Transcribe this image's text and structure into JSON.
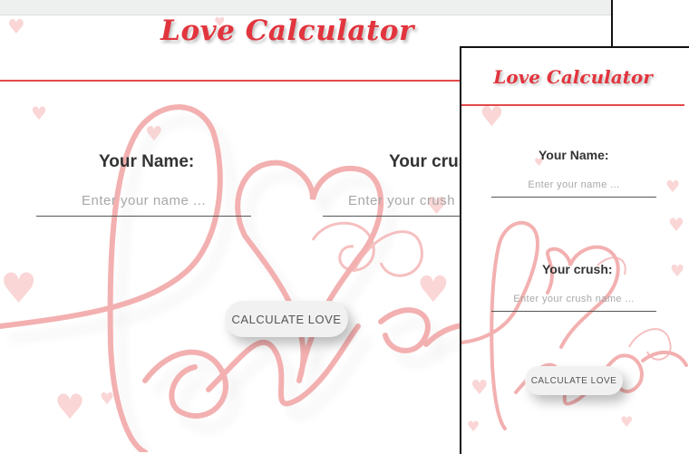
{
  "desktop": {
    "title": "Love Calculator",
    "name_label": "Your Name:",
    "name_placeholder": "Enter your name ...",
    "crush_label": "Your crush:",
    "crush_placeholder": "Enter your crush name ...",
    "button_label": "CALCULATE LOVE"
  },
  "mobile": {
    "title": "Love Calculator",
    "name_label": "Your Name:",
    "name_placeholder": "Enter your name ...",
    "crush_label": "Your crush:",
    "crush_placeholder": "Enter your crush name ...",
    "button_label": "CALCULATE LOVE"
  },
  "colors": {
    "title": "#e2343d",
    "header_line": "#e34a4a",
    "love_script": "#f2a3a3",
    "hearts": "#f8c6c6"
  },
  "icons": [
    "love-script-heart-background",
    "heart-icon"
  ]
}
